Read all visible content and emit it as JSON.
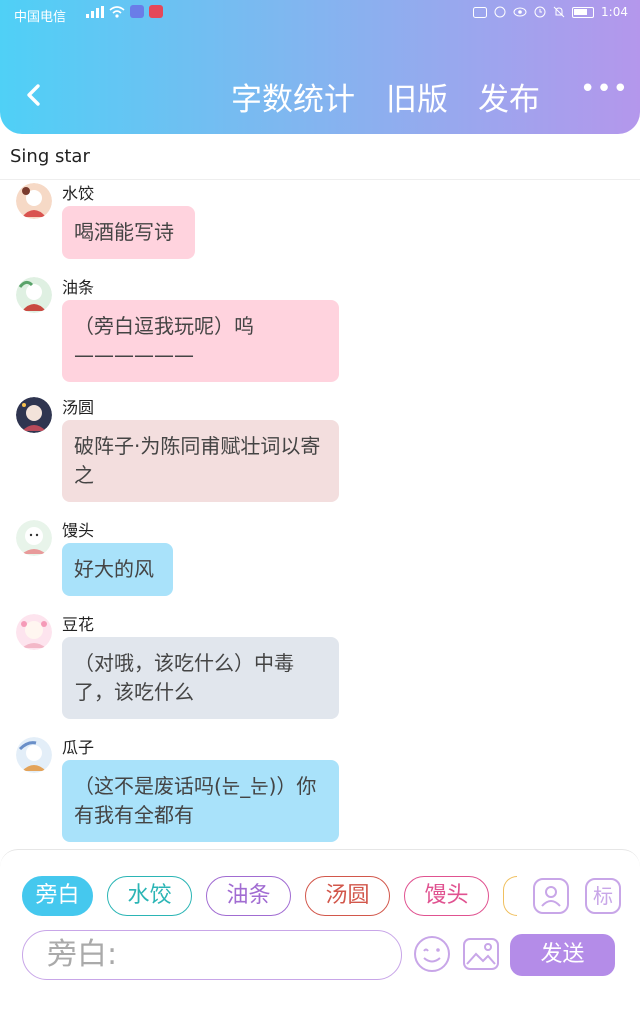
{
  "status_bar": {
    "carrier": "中国电信",
    "time": "1:04"
  },
  "header": {
    "nav": [
      "字数统计",
      "旧版",
      "发布"
    ],
    "more": "•••"
  },
  "subtitle": "Sing star",
  "messages": [
    {
      "name": "水饺",
      "text": "喝酒能写诗",
      "bubble_color": "#ffd3de"
    },
    {
      "name": "油条",
      "text": "（旁白逗我玩呢）呜——————",
      "bubble_color": "#ffd3de"
    },
    {
      "name": "汤圆",
      "text": "破阵子·为陈同甫赋壮词以寄之",
      "bubble_color": "#f3dede"
    },
    {
      "name": "馒头",
      "text": "好大的风",
      "bubble_color": "#a9e2fa"
    },
    {
      "name": "豆花",
      "text": "（对哦，该吃什么）中毒了，该吃什么",
      "bubble_color": "#e1e6ed"
    },
    {
      "name": "瓜子",
      "text": "（这不是废话吗(눈_눈)）你有我有全都有",
      "bubble_color": "#a9e2fa"
    }
  ],
  "characters": [
    {
      "label": "旁白",
      "color": "#45c8ee",
      "active": true
    },
    {
      "label": "水饺",
      "color": "#2bb5b5",
      "active": false
    },
    {
      "label": "油条",
      "color": "#a16cd2",
      "active": false
    },
    {
      "label": "汤圆",
      "color": "#d2574b",
      "active": false
    },
    {
      "label": "馒头",
      "color": "#e05290",
      "active": false
    }
  ],
  "tag_label": "标",
  "input": {
    "placeholder": "旁白:"
  },
  "send_label": "发送"
}
